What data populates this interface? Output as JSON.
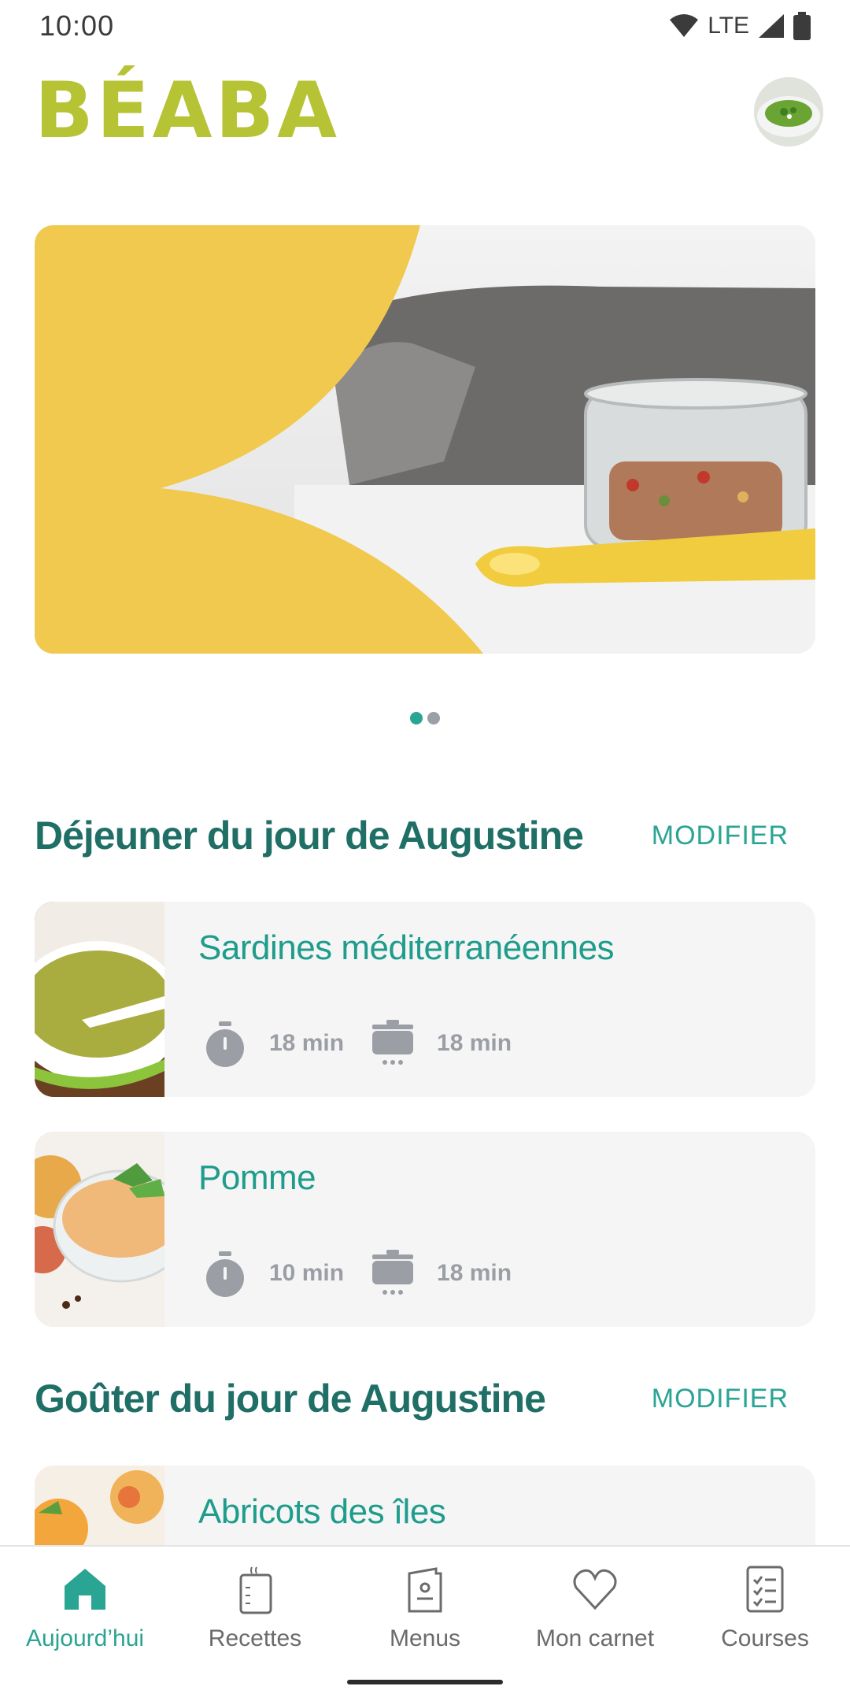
{
  "status_bar": {
    "time": "10:00",
    "network": "LTE"
  },
  "header": {
    "logo": "BÉABA",
    "avatar_icon": "avatar-soup-photo"
  },
  "carousel": {
    "page_count": 2,
    "active_index": 0
  },
  "sections": [
    {
      "title": "Déjeuner du jour de Augustine",
      "action": "MODIFIER",
      "recipes": [
        {
          "title": "Sardines méditerranéennes",
          "prep_time": "18 min",
          "cook_time": "18 min"
        },
        {
          "title": "Pomme",
          "prep_time": "10 min",
          "cook_time": "18 min"
        }
      ]
    },
    {
      "title": "Goûter du jour de Augustine",
      "action": "MODIFIER",
      "recipes": [
        {
          "title": "Abricots des îles"
        }
      ]
    }
  ],
  "bottom_nav": [
    {
      "label": "Aujourd’hui",
      "icon": "home-icon",
      "active": true
    },
    {
      "label": "Recettes",
      "icon": "recipe-book-icon",
      "active": false
    },
    {
      "label": "Menus",
      "icon": "menu-card-icon",
      "active": false
    },
    {
      "label": "Mon carnet",
      "icon": "heart-icon",
      "active": false
    },
    {
      "label": "Courses",
      "icon": "checklist-icon",
      "active": false
    }
  ],
  "colors": {
    "brand_green": "#b5c334",
    "teal_dark": "#1f6f66",
    "teal": "#2aa493",
    "hero_yellow": "#f0c94e"
  }
}
